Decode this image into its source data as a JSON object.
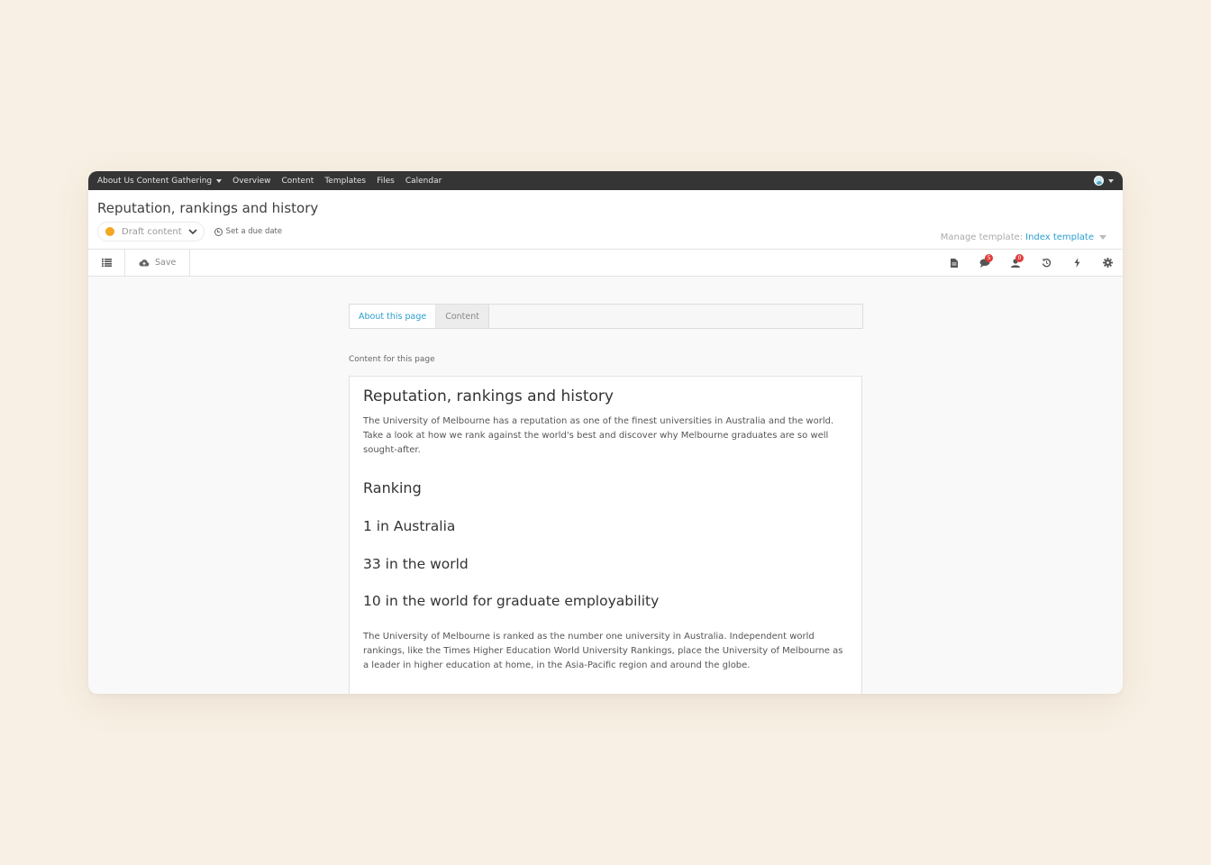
{
  "topnav": {
    "project": "About Us Content Gathering",
    "items": [
      "Overview",
      "Content",
      "Templates",
      "Files",
      "Calendar"
    ]
  },
  "header": {
    "title": "Reputation, rankings and history",
    "status": "Draft content",
    "status_color": "#f5a623",
    "due_date": "Set a due date",
    "manage_template_label": "Manage template:",
    "template_name": "Index template"
  },
  "toolbar": {
    "save_label": "Save",
    "comments_count": "5",
    "assignees_count": "0"
  },
  "tabs": [
    {
      "label": "About this page",
      "active": true
    },
    {
      "label": "Content",
      "active": false
    }
  ],
  "content": {
    "section_label": "Content for this page",
    "heading": "Reputation, rankings and history",
    "intro": "The University of Melbourne has a reputation as one of the finest universities in Australia and the world. Take a look at how we rank against the world's best and discover why Melbourne graduates are so well sought-after.",
    "ranking_heading": "Ranking",
    "ranks": [
      "1 in Australia",
      "33 in the world",
      "10 in the world for graduate employability"
    ],
    "body": "The University of Melbourne is ranked as the number one university in Australia. Independent world rankings, like the Times Higher Education World University Rankings, place the University of Melbourne as a leader in higher education at home, in the Asia-Pacific region and around the globe."
  },
  "colors": {
    "accent": "#2a9fd0",
    "nav_bg": "#353535",
    "badge": "#e03c3c",
    "page_bg": "#f8f0e4"
  }
}
